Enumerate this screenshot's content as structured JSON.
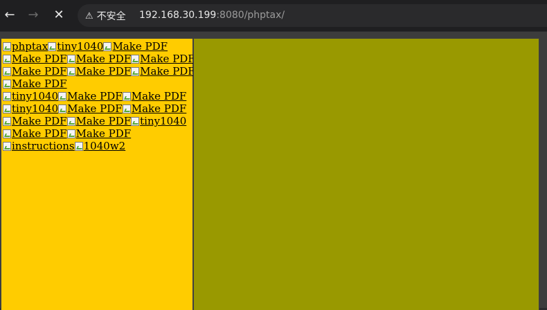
{
  "browser": {
    "security_label": "不安全",
    "url_host": "192.168.30.199",
    "url_rest": ":8080/phptax/"
  },
  "left_frame": {
    "rows": [
      [
        "phptax",
        "tiny1040",
        "Make PDF"
      ],
      [
        "Make PDF",
        "Make PDF",
        "Make PDF"
      ],
      [
        "Make PDF",
        "Make PDF",
        "Make PDF"
      ],
      [
        "Make PDF"
      ],
      [
        "tiny1040",
        "Make PDF",
        "Make PDF"
      ],
      [
        "tiny1040",
        "Make PDF",
        "Make PDF"
      ],
      [
        "Make PDF",
        "Make PDF",
        "tiny1040"
      ],
      [
        "Make PDF",
        "Make PDF"
      ],
      [
        "instructions",
        "1040w2"
      ]
    ],
    "background": "#ffcc00"
  },
  "right_frame": {
    "background": "#999900"
  }
}
